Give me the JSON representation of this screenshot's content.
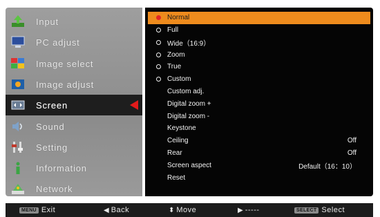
{
  "menu": {
    "items": [
      {
        "label": "Input",
        "icon": "input-icon"
      },
      {
        "label": "PC adjust",
        "icon": "pc-adjust-icon"
      },
      {
        "label": "Image select",
        "icon": "image-select-icon"
      },
      {
        "label": "Image adjust",
        "icon": "image-adjust-icon"
      },
      {
        "label": "Screen",
        "icon": "screen-icon"
      },
      {
        "label": "Sound",
        "icon": "sound-icon"
      },
      {
        "label": "Setting",
        "icon": "setting-icon"
      },
      {
        "label": "Information",
        "icon": "information-icon"
      },
      {
        "label": "Network",
        "icon": "network-icon"
      }
    ],
    "active_index": 4
  },
  "submenu": {
    "items": [
      {
        "label": "Normal",
        "radio": "selected",
        "value": ""
      },
      {
        "label": "Full",
        "radio": "ring",
        "value": ""
      },
      {
        "label": "Wide（16:9）",
        "radio": "ring",
        "value": ""
      },
      {
        "label": "Zoom",
        "radio": "ring",
        "value": ""
      },
      {
        "label": "True",
        "radio": "ring",
        "value": ""
      },
      {
        "label": "Custom",
        "radio": "ring",
        "value": ""
      },
      {
        "label": "Custom adj.",
        "radio": "none",
        "value": ""
      },
      {
        "label": "Digital zoom +",
        "radio": "none",
        "value": ""
      },
      {
        "label": "Digital zoom -",
        "radio": "none",
        "value": ""
      },
      {
        "label": "Keystone",
        "radio": "none",
        "value": ""
      },
      {
        "label": "Ceiling",
        "radio": "none",
        "value": "Off"
      },
      {
        "label": "Rear",
        "radio": "none",
        "value": "Off"
      },
      {
        "label": "Screen aspect",
        "radio": "none",
        "value": "Default（16：10）"
      },
      {
        "label": "Reset",
        "radio": "none",
        "value": ""
      }
    ]
  },
  "bottom_bar": {
    "exit": {
      "key": "MENU",
      "label": "Exit"
    },
    "back": {
      "symbol": "◀",
      "label": "Back"
    },
    "move": {
      "symbol": "⬍",
      "label": "Move"
    },
    "enter": {
      "symbol": "▶",
      "label": "-----"
    },
    "select": {
      "key": "SELECT",
      "label": "Select"
    }
  },
  "colors": {
    "selected_row": "#ee8b1d",
    "active_arrow": "#e21b1b",
    "radio_selected": "#e22727"
  }
}
